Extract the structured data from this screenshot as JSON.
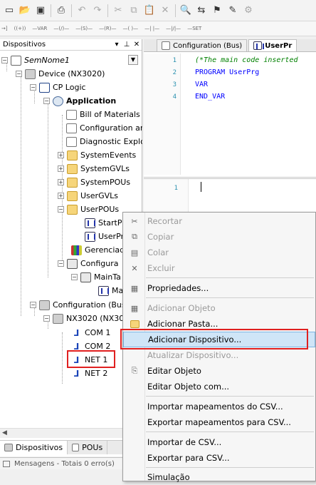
{
  "toolbar": {
    "icons": [
      "new-file-icon",
      "open-folder-icon",
      "save-icon",
      "print-icon",
      "undo-icon",
      "redo-icon",
      "cut-icon",
      "copy-icon",
      "paste-icon",
      "delete-icon",
      "find-icon",
      "replace-icon",
      "bookmark-icon",
      "build-icon",
      "device-icon"
    ],
    "secondary_labels": [
      "→]",
      "((+))",
      "—VAR",
      "—(/)—",
      "—(S)—",
      "—(R)—",
      "—( )—",
      "—| |—",
      "—|/|—",
      "—SET"
    ]
  },
  "left_panel": {
    "title": "Dispositivos",
    "tree": {
      "root": "SemNome1",
      "device": "Device (NX3020)",
      "cp_logic": "CP Logic",
      "application": "Application",
      "bill": "Bill of Materials",
      "config_ar": "Configuration ar",
      "diag": "Diagnostic Explo",
      "sys_events": "SystemEvents",
      "sys_gvls": "SystemGVLs",
      "sys_pous": "SystemPOUs",
      "user_gvls": "UserGVLs",
      "user_pous": "UserPOUs",
      "startp": "StartP",
      "userpr": "UserPr",
      "gerenciado": "Gerenciado",
      "configura": "Configura",
      "maintask": "MainTa",
      "ma": "Ma",
      "config_bus": "Configuration (Bus)",
      "nx3020": "NX3020 (NX30",
      "com1": "COM 1",
      "com2": "COM 2",
      "net1": "NET 1",
      "net2": "NET 2"
    },
    "bottom_tabs": [
      "Dispositivos",
      "POUs"
    ]
  },
  "editor": {
    "tabs": [
      "Configuration (Bus)",
      "UserPr"
    ],
    "code": [
      {
        "n": "1",
        "text": "(*The main code inserted",
        "kind": "comment"
      },
      {
        "n": "2",
        "text": "PROGRAM UserPrg",
        "kind": "keyword"
      },
      {
        "n": "3",
        "text": "VAR",
        "kind": "keyword"
      },
      {
        "n": "4",
        "text": "END_VAR",
        "kind": "keyword"
      }
    ],
    "code2_line": "1"
  },
  "status": "Mensagens - Totais 0 erro(s)",
  "context_menu": {
    "items": [
      {
        "label": "Recortar",
        "disabled": true,
        "icon": "cut-icon"
      },
      {
        "label": "Copiar",
        "disabled": true,
        "icon": "copy-icon"
      },
      {
        "label": "Colar",
        "disabled": true,
        "icon": "paste-icon"
      },
      {
        "label": "Excluir",
        "disabled": true,
        "icon": "delete-icon"
      },
      {
        "label": "Propriedades...",
        "disabled": false,
        "icon": "properties-icon"
      },
      {
        "label": "Adicionar Objeto",
        "disabled": true,
        "icon": "add-object-icon"
      },
      {
        "label": "Adicionar Pasta...",
        "disabled": false,
        "icon": "folder-icon"
      },
      {
        "label": "Adicionar Dispositivo...",
        "disabled": false,
        "icon": "",
        "selected": true
      },
      {
        "label": "Atualizar Dispositivo...",
        "disabled": true,
        "icon": ""
      },
      {
        "label": "Editar Objeto",
        "disabled": false,
        "icon": "edit-object-icon"
      },
      {
        "label": "Editar Objeto com...",
        "disabled": false,
        "icon": ""
      },
      {
        "label": "Importar mapeamentos do CSV...",
        "disabled": false,
        "icon": ""
      },
      {
        "label": "Exportar mapeamentos para CSV...",
        "disabled": false,
        "icon": ""
      },
      {
        "label": "Importar de CSV...",
        "disabled": false,
        "icon": ""
      },
      {
        "label": "Exportar para CSV...",
        "disabled": false,
        "icon": ""
      },
      {
        "label": "Simulação",
        "disabled": false,
        "icon": ""
      }
    ]
  },
  "colors": {
    "highlight": "#e02020",
    "selection": "#cfe5f7",
    "keyword": "#0000ff",
    "comment": "#008000"
  }
}
